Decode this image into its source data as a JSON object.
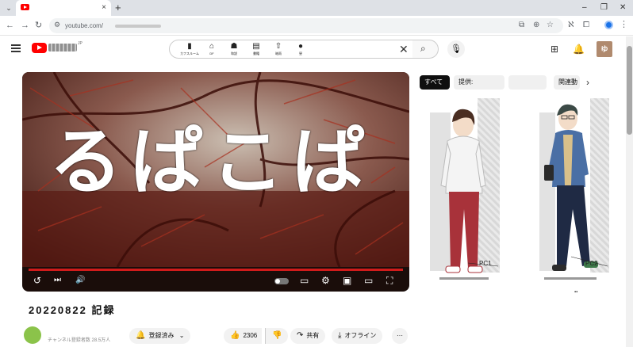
{
  "browser": {
    "tab_close": "×",
    "new_tab": "+",
    "tab_menu": "⌄",
    "win_min": "–",
    "win_max": "❐",
    "win_close": "✕",
    "url": "youtube.com/",
    "nav": {
      "back": "←",
      "forward": "→",
      "reload": "↻"
    }
  },
  "masthead": {
    "logo_sup": "JP",
    "search_emoji": [
      {
        "glyph": "▮",
        "label": "カフスルーム",
        "icon": "door-icon"
      },
      {
        "glyph": "⌂",
        "label": "DF",
        "icon": "house-icon"
      },
      {
        "glyph": "☗",
        "label": "和説",
        "icon": "figure-icon"
      },
      {
        "glyph": "▤",
        "label": "書籍",
        "icon": "book-icon"
      },
      {
        "glyph": "⇧",
        "label": "暗雨",
        "icon": "arrow-icon"
      },
      {
        "glyph": "●",
        "label": "昼",
        "icon": "circle-icon"
      }
    ],
    "search_clear": "✕",
    "search_icon": "⌕",
    "mic_icon": "🎤",
    "create_icon": "⊞",
    "bell_icon": "🔔",
    "avatar_text": "ゆ"
  },
  "player": {
    "video_text": "るぱこぱ",
    "controls": {
      "replay": "↺",
      "next": "⏭",
      "volume": "🔊",
      "subtitles": "▭",
      "settings": "⚙",
      "miniplayer": "▣",
      "theater": "▭",
      "fullscreen": "⛶"
    },
    "progress_fraction": 1.0
  },
  "video": {
    "title": "20220822 記録",
    "channel_sub": "チャンネル登録者数 28.5万人"
  },
  "actions": {
    "subscribe_label": "登録済み",
    "subscribe_icon": "🔔",
    "subscribe_caret": "⌄",
    "like_count": "2306",
    "like_icon": "👍",
    "dislike_icon": "👎",
    "share_label": "共有",
    "share_icon": "↷",
    "offline_label": "オフライン",
    "offline_icon": "⤓",
    "more_label": "···"
  },
  "sidebar": {
    "chips": [
      {
        "label": "すべて",
        "active": true
      },
      {
        "label": "提供:",
        "active": false
      },
      {
        "label": "",
        "active": false
      },
      {
        "label": "関連動",
        "active": false
      }
    ],
    "chip_next": "›",
    "cards": [
      {
        "label": "PC1",
        "hoodie": "#f4f4f4",
        "pants": "#a8323a"
      },
      {
        "label": "PC2",
        "hoodie": "#4a6fa5",
        "pants": "#1f2a44"
      }
    ]
  }
}
